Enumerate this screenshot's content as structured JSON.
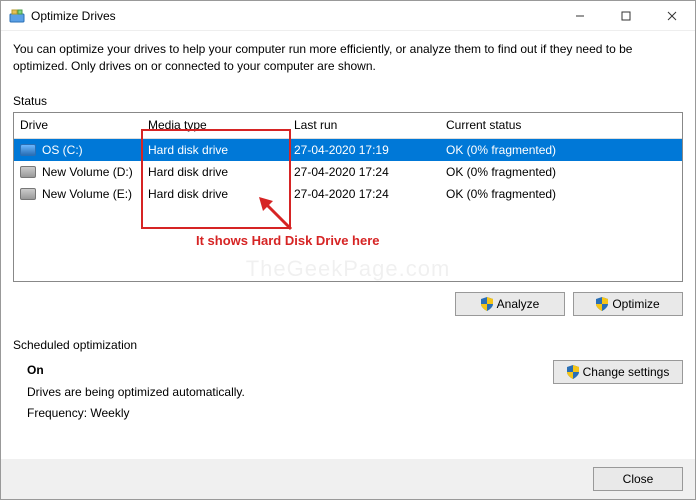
{
  "window": {
    "title": "Optimize Drives"
  },
  "intro": "You can optimize your drives to help your computer run more efficiently, or analyze them to find out if they need to be optimized. Only drives on or connected to your computer are shown.",
  "status_label": "Status",
  "columns": {
    "drive": "Drive",
    "media": "Media type",
    "last": "Last run",
    "status": "Current status"
  },
  "rows": [
    {
      "drive": "OS (C:)",
      "media": "Hard disk drive",
      "last": "27-04-2020 17:19",
      "status": "OK (0% fragmented)",
      "selected": true,
      "os": true
    },
    {
      "drive": "New Volume (D:)",
      "media": "Hard disk drive",
      "last": "27-04-2020 17:24",
      "status": "OK (0% fragmented)",
      "selected": false,
      "os": false
    },
    {
      "drive": "New Volume (E:)",
      "media": "Hard disk drive",
      "last": "27-04-2020 17:24",
      "status": "OK (0% fragmented)",
      "selected": false,
      "os": false
    }
  ],
  "buttons": {
    "analyze": "Analyze",
    "optimize": "Optimize",
    "change_settings": "Change settings",
    "close": "Close"
  },
  "scheduled": {
    "label": "Scheduled optimization",
    "on": "On",
    "desc": "Drives are being optimized automatically.",
    "freq": "Frequency: Weekly"
  },
  "annotation": {
    "text": "It shows Hard Disk Drive here"
  }
}
